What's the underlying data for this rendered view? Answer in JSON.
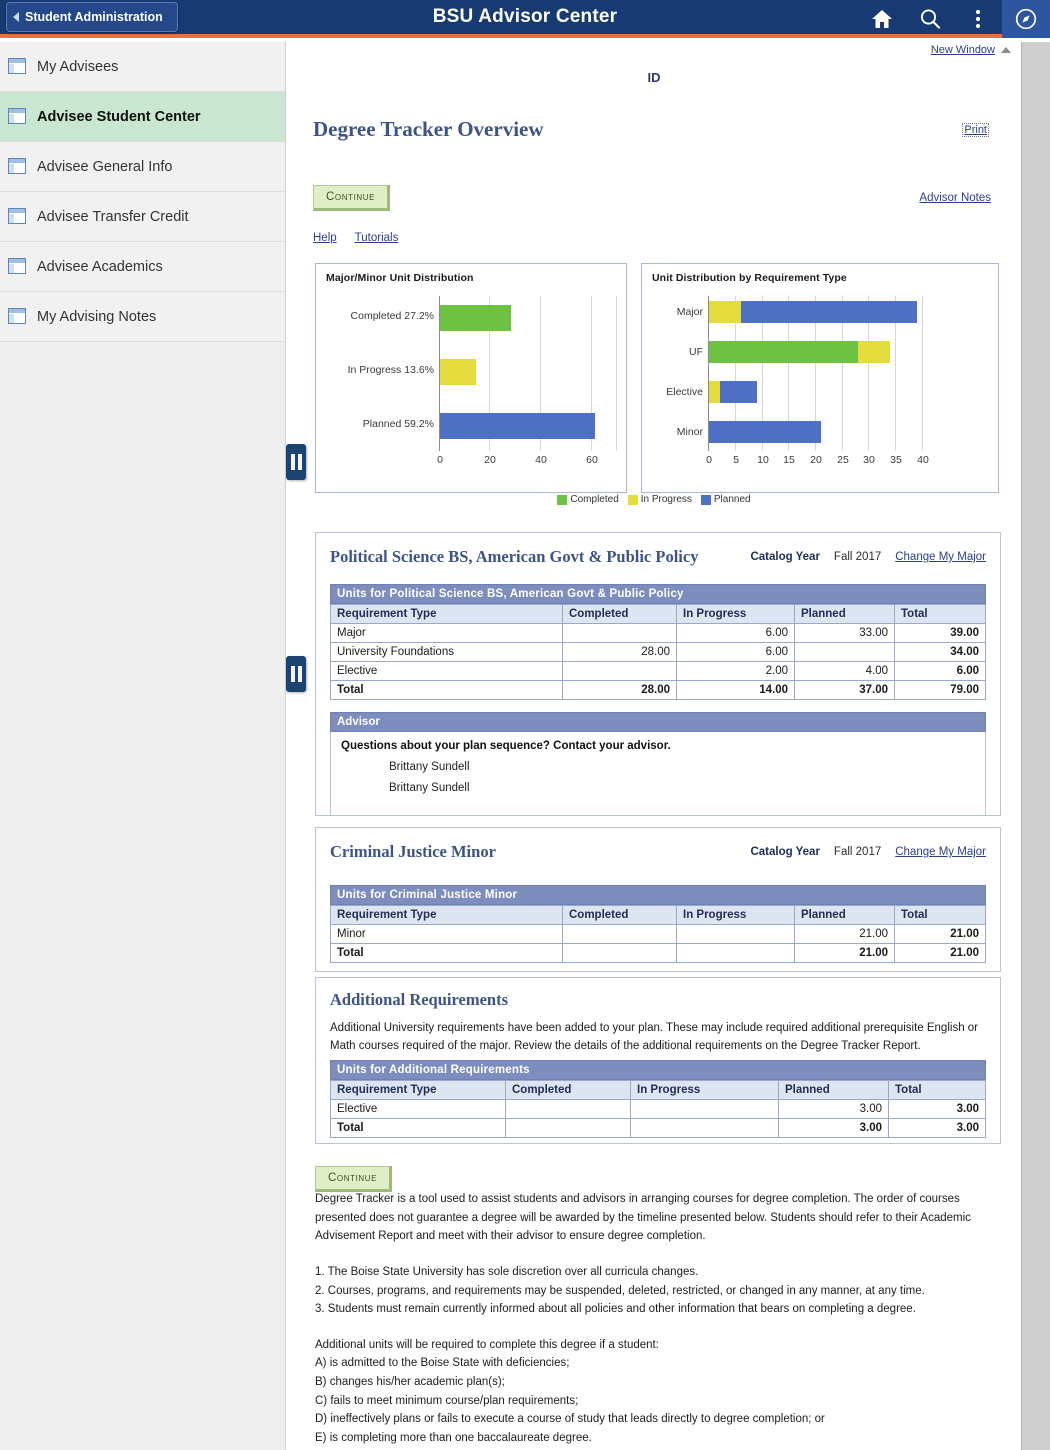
{
  "header": {
    "back_label": "Student Administration",
    "title": "BSU Advisor Center",
    "icons": [
      "home-icon",
      "search-icon",
      "more-vertical-icon",
      "compass-icon"
    ]
  },
  "sidebar": {
    "items": [
      {
        "label": "My Advisees",
        "selected": false
      },
      {
        "label": "Advisee Student Center",
        "selected": true
      },
      {
        "label": "Advisee General Info",
        "selected": false
      },
      {
        "label": "Advisee Transfer Credit",
        "selected": false
      },
      {
        "label": "Advisee Academics",
        "selected": false
      },
      {
        "label": "My Advising Notes",
        "selected": false
      }
    ]
  },
  "main": {
    "new_window": "New Window",
    "id_label": "ID",
    "page_title": "Degree Tracker Overview",
    "print": "Print",
    "continue_top": "Continue",
    "advisor_notes": "Advisor Notes",
    "help": "Help",
    "tutorials": "Tutorials",
    "continue_bottom": "Continue"
  },
  "chart_data": [
    {
      "type": "bar",
      "title": "Major/Minor Unit Distribution",
      "orientation": "horizontal",
      "categories": [
        "Completed 27.2%",
        "In Progress 13.6%",
        "Planned 59.2%"
      ],
      "values": [
        28,
        14,
        61
      ],
      "colors": [
        "#6ec241",
        "#e4db3c",
        "#4d6fc4"
      ],
      "xlabel": "",
      "ylabel": "",
      "xlim": [
        0,
        70
      ],
      "xticks": [
        0,
        20,
        40,
        60
      ],
      "grid": true,
      "legend_position": "bottom"
    },
    {
      "type": "bar",
      "subtype": "stacked",
      "title": "Unit Distribution by Requirement Type",
      "orientation": "horizontal",
      "categories": [
        "Major",
        "UF",
        "Elective",
        "Minor"
      ],
      "series": [
        {
          "name": "Completed",
          "color": "#6ec241",
          "values": [
            0,
            28,
            0,
            0
          ]
        },
        {
          "name": "In Progress",
          "color": "#e4db3c",
          "values": [
            6,
            6,
            2,
            0
          ]
        },
        {
          "name": "Planned",
          "color": "#4d6fc4",
          "values": [
            33,
            0,
            7,
            21
          ]
        }
      ],
      "stack_order": {
        "Major": [
          "In Progress",
          "Planned"
        ],
        "UF": [
          "Completed",
          "In Progress"
        ],
        "Elective": [
          "In Progress",
          "Planned"
        ],
        "Minor": [
          "Planned"
        ]
      },
      "xlabel": "",
      "ylabel": "",
      "xlim": [
        0,
        42
      ],
      "xticks": [
        0,
        5,
        10,
        15,
        20,
        25,
        30,
        35,
        40
      ],
      "grid": true,
      "legend_position": "bottom"
    }
  ],
  "legend": [
    {
      "label": "Completed",
      "color": "#6ec241"
    },
    {
      "label": "In Progress",
      "color": "#e4db3c"
    },
    {
      "label": "Planned",
      "color": "#4d6fc4"
    }
  ],
  "plan_major": {
    "title": "Political Science BS, American Govt & Public Policy",
    "catalog_label": "Catalog Year",
    "catalog_year": "Fall 2017",
    "change_link": "Change My Major",
    "table_caption": "Units for Political Science BS, American Govt & Public Policy",
    "columns": [
      "Requirement Type",
      "Completed",
      "In Progress",
      "Planned",
      "Total"
    ],
    "rows": [
      {
        "type": "Major",
        "completed": "",
        "in_progress": "6.00",
        "planned": "33.00",
        "total": "39.00"
      },
      {
        "type": "University Foundations",
        "completed": "28.00",
        "in_progress": "6.00",
        "planned": "",
        "total": "34.00"
      },
      {
        "type": "Elective",
        "completed": "",
        "in_progress": "2.00",
        "planned": "4.00",
        "total": "6.00"
      }
    ],
    "total_row": {
      "type": "Total",
      "completed": "28.00",
      "in_progress": "14.00",
      "planned": "37.00",
      "total": "79.00"
    },
    "advisor_band": "Advisor",
    "advisor_question": "Questions about your plan sequence? Contact your advisor.",
    "advisor_names": [
      "Brittany Sundell",
      "Brittany Sundell"
    ]
  },
  "plan_minor": {
    "title": "Criminal Justice Minor",
    "catalog_label": "Catalog Year",
    "catalog_year": "Fall 2017",
    "change_link": "Change My Major",
    "table_caption": "Units for Criminal Justice Minor",
    "columns": [
      "Requirement Type",
      "Completed",
      "In Progress",
      "Planned",
      "Total"
    ],
    "rows": [
      {
        "type": "Minor",
        "completed": "",
        "in_progress": "",
        "planned": "21.00",
        "total": "21.00"
      }
    ],
    "total_row": {
      "type": "Total",
      "completed": "",
      "in_progress": "",
      "planned": "21.00",
      "total": "21.00"
    }
  },
  "additional": {
    "title": "Additional Requirements",
    "paragraph": "Additional University requirements have been added to your plan. These may include required additional prerequisite English or Math courses required of the major. Review the details of the additional requirements on the Degree Tracker Report.",
    "table_caption": "Units for Additional Requirements",
    "columns": [
      "Requirement Type",
      "Completed",
      "In Progress",
      "Planned",
      "Total"
    ],
    "rows": [
      {
        "type": "Elective",
        "completed": "",
        "in_progress": "",
        "planned": "3.00",
        "total": "3.00"
      }
    ],
    "total_row": {
      "type": "Total",
      "completed": "",
      "in_progress": "",
      "planned": "3.00",
      "total": "3.00"
    }
  },
  "footer": {
    "intro": "Degree Tracker is a tool used to assist students and advisors in arranging courses for degree completion. The order of courses presented does not guarantee a degree will be awarded by the timeline presented below. Students should refer to their Academic Advisement Report and meet with their advisor to ensure degree completion.",
    "numbered": [
      "1. The Boise State University has sole discretion over all curricula changes.",
      "2. Courses, programs, and requirements may be suspended, deleted, restricted, or changed in any manner, at any time.",
      "3. Students must remain currently informed about all policies and other information that bears on completing a degree."
    ],
    "additional_intro": "Additional units will be required to complete this degree if a student:",
    "lettered": [
      "A) is admitted to the Boise State with deficiencies;",
      "B) changes his/her academic plan(s);",
      "C) fails to meet minimum course/plan requirements;",
      "D) ineffectively plans or fails to execute a course of study that leads directly to degree completion; or",
      "E) is completing more than one baccalaureate degree."
    ]
  }
}
